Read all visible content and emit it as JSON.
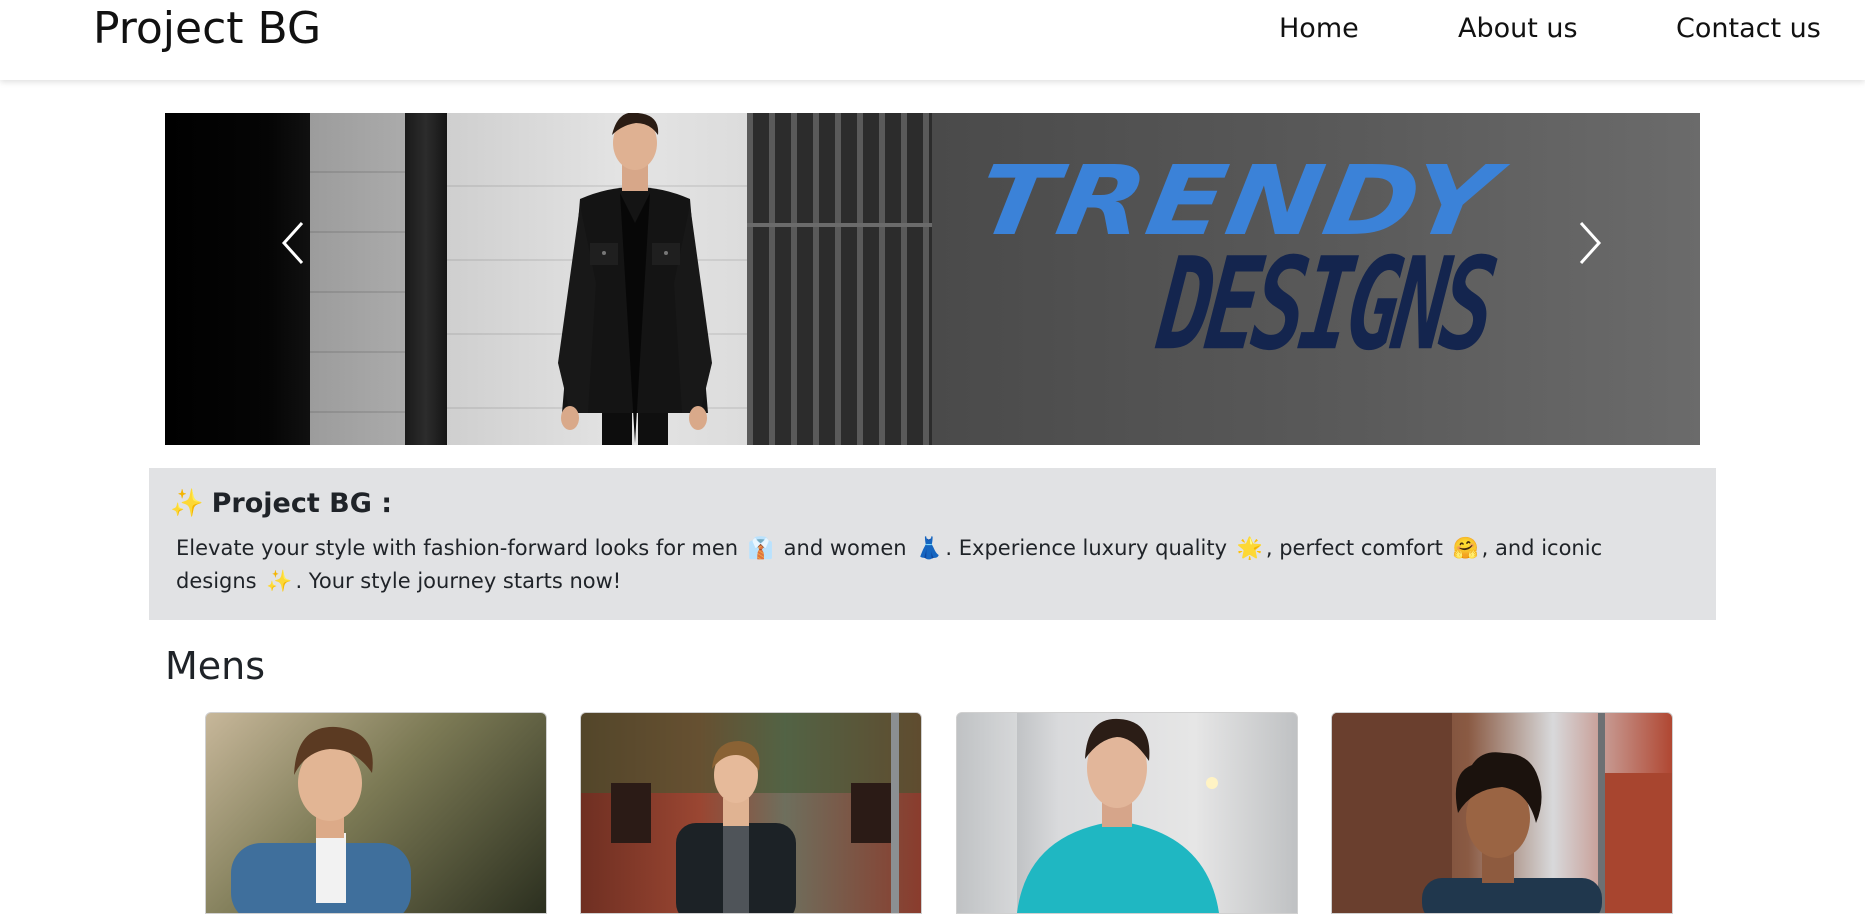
{
  "navbar": {
    "brand": "Project BG",
    "links": [
      "Home",
      "About us",
      "Contact us"
    ]
  },
  "carousel": {
    "slide_headline": "TRENDY",
    "slide_subheadline": "DESIGNS",
    "prev_icon": "chevron-left-icon",
    "next_icon": "chevron-right-icon"
  },
  "about": {
    "title_icon": "✨",
    "title": "Project BG :",
    "text_1": "Elevate your style with fashion-forward looks for men",
    "emoji_1": "👔",
    "text_2": "and women",
    "emoji_2": "👗",
    "text_3": ". Experience luxury quality",
    "emoji_3": "🌟",
    "text_4": ", perfect comfort",
    "emoji_4": "🤗",
    "text_5": ", and iconic designs",
    "emoji_5": "✨",
    "text_6": ". Your style journey starts now!"
  },
  "mens": {
    "title": "Mens",
    "cards": [
      {
        "image": "man-denim-jacket-photo"
      },
      {
        "image": "man-dark-coat-street-photo"
      },
      {
        "image": "man-teal-shirt-photo"
      },
      {
        "image": "man-curly-hair-street-photo"
      }
    ]
  },
  "colors": {
    "accent_blue": "#3b82d8",
    "designs_navy": "#14254e",
    "about_bg": "#e1e2e4"
  }
}
